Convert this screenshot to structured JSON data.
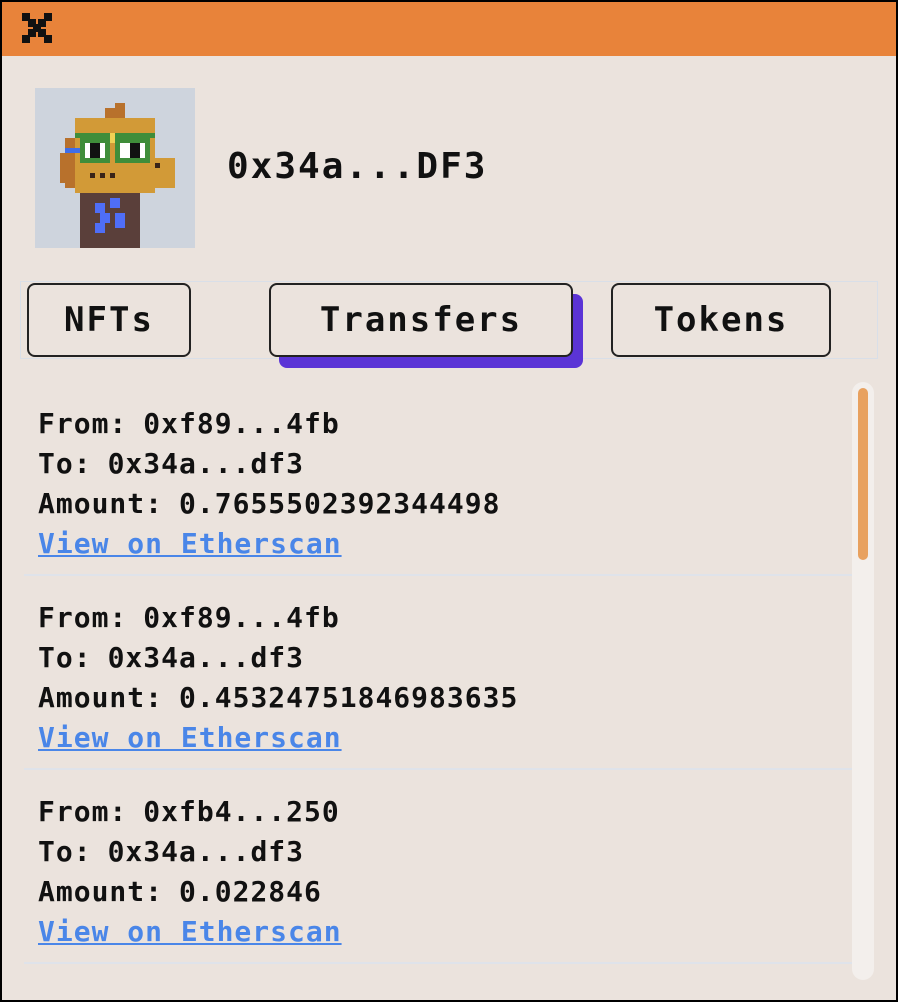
{
  "window": {
    "close_icon": "close-icon",
    "accent_color": "#e8833a"
  },
  "profile": {
    "avatar_icon": "pixel-avatar-icon",
    "address": "0x34a...DF3"
  },
  "tabs": [
    {
      "label": "NFTs",
      "active": false
    },
    {
      "label": "Transfers",
      "active": true
    },
    {
      "label": "Tokens",
      "active": false
    }
  ],
  "transfers": [
    {
      "from_label": "From:",
      "from": "0xf89...4fb",
      "to_label": "To:",
      "to": "0x34a...df3",
      "amount_label": "Amount:",
      "amount": "0.7655502392344498",
      "link": "View on Etherscan"
    },
    {
      "from_label": "From:",
      "from": "0xf89...4fb",
      "to_label": "To:",
      "to": "0x34a...df3",
      "amount_label": "Amount:",
      "amount": "0.45324751846983635",
      "link": "View on Etherscan"
    },
    {
      "from_label": "From:",
      "from": "0xfb4...250",
      "to_label": "To:",
      "to": "0x34a...df3",
      "amount_label": "Amount:",
      "amount": "0.022846",
      "link": "View on Etherscan"
    }
  ],
  "colors": {
    "titlebar": "#e8833a",
    "background": "#ebe3dd",
    "link": "#4a86e8",
    "active_tab_shadow": "#5b34d6",
    "scroll_thumb": "#e8a15f"
  }
}
